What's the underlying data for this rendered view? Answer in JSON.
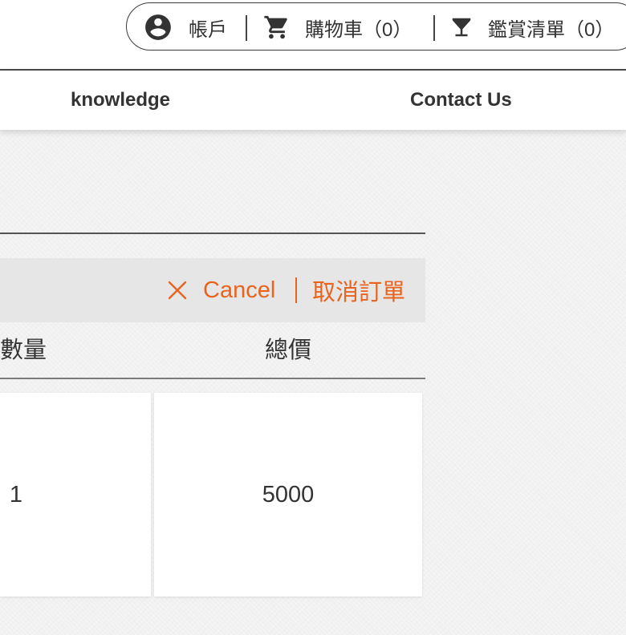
{
  "utility_bar": {
    "account_label": "帳戶",
    "cart_label": "購物車（0）",
    "wishlist_label": "鑑賞清單（0）"
  },
  "nav": {
    "items": [
      {
        "label": "knowledge"
      },
      {
        "label": "Contact Us"
      }
    ]
  },
  "order": {
    "cancel_label": "Cancel",
    "cancel_label_zh": "取消訂單",
    "columns": [
      "數量",
      "總價"
    ],
    "rows": [
      {
        "quantity": "1",
        "total": "5000"
      }
    ]
  },
  "colors": {
    "accent": "#e8641e",
    "text": "#333333",
    "action_bar_bg": "#e6e6e6",
    "page_bg": "#f1f1f1"
  },
  "icons": {
    "account": "account-circle-icon",
    "cart": "shopping-cart-icon",
    "wishlist": "cocktail-glass-icon",
    "cancel": "close-icon"
  }
}
